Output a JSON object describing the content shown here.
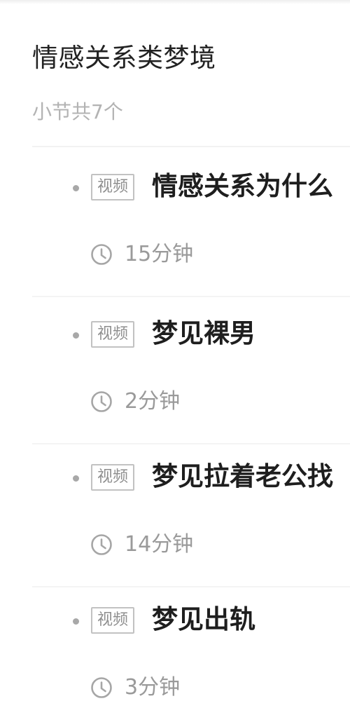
{
  "section": {
    "title": "情感关系类梦境",
    "count_label": "小节共7个"
  },
  "lessons": [
    {
      "tag": "视频",
      "title": "情感关系为什么",
      "duration": "15分钟"
    },
    {
      "tag": "视频",
      "title": "梦见裸男",
      "duration": "2分钟"
    },
    {
      "tag": "视频",
      "title": "梦见拉着老公找",
      "duration": "14分钟"
    },
    {
      "tag": "视频",
      "title": "梦见出轨",
      "duration": "3分钟"
    }
  ],
  "icons": {
    "bullet": "bullet-dot-icon",
    "clock": "clock-icon"
  },
  "colors": {
    "title": "#222222",
    "muted": "#b3b3b3",
    "duration": "#9a9a9a",
    "tag_border": "#c2c2c2"
  }
}
